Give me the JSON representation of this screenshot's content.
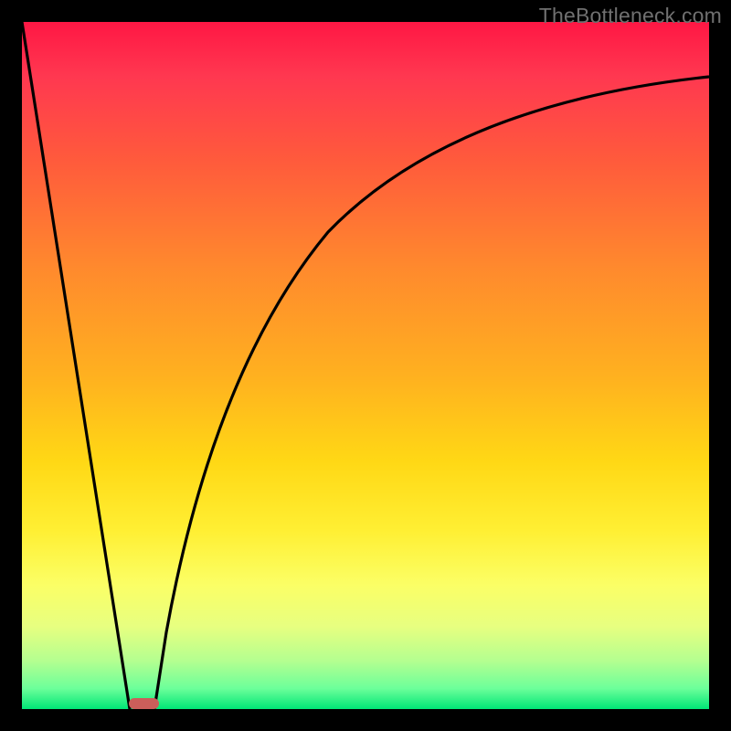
{
  "watermark": "TheBottleneck.com",
  "colors": {
    "frame": "#000000",
    "pill": "#cb5e5a",
    "curve": "#000000",
    "gradient_top": "#ff1744",
    "gradient_bottom": "#00e676"
  },
  "chart_data": {
    "type": "line",
    "title": "",
    "xlabel": "",
    "ylabel": "",
    "xlim": [
      0,
      100
    ],
    "ylim": [
      0,
      100
    ],
    "grid": false,
    "legend": false,
    "series": [
      {
        "name": "left-line",
        "x": [
          0,
          15.7
        ],
        "values": [
          100,
          0
        ]
      },
      {
        "name": "right-curve",
        "x": [
          19.3,
          22,
          25,
          28,
          32,
          36,
          40,
          45,
          50,
          56,
          62,
          70,
          78,
          86,
          94,
          100
        ],
        "values": [
          0,
          16,
          29,
          39,
          49,
          57,
          63,
          69,
          74,
          78,
          81.5,
          85,
          87.5,
          89.5,
          91,
          92
        ]
      }
    ],
    "annotations": [
      {
        "name": "pill-marker",
        "x": 17.5,
        "y": 0,
        "w": 4.3,
        "h": 1.6
      }
    ]
  }
}
